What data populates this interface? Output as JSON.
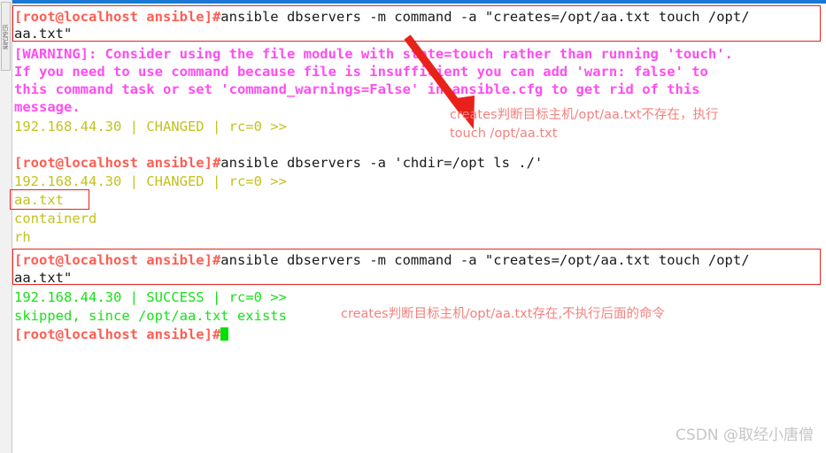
{
  "window": {
    "side_rail_label": "历史记录",
    "accent_color": "#1a78d2"
  },
  "terminal": {
    "background": "#ffffff",
    "colors": {
      "prompt": "#ff5d52",
      "command": "#1a1a1a",
      "warning": "#ff4df0",
      "changed": "#c2c21f",
      "success": "#19e019",
      "cursor": "#00e000",
      "annotation_box": "#e8221b",
      "annotation_text": "#f4827e"
    },
    "prompt_text": "[root@localhost ansible]#",
    "lines": [
      {
        "id": "cmd1",
        "kind": "prompt",
        "prompt": "[root@localhost ansible]#",
        "text": "ansible dbservers -m command -a \"creates=/opt/aa.txt touch /opt/"
      },
      {
        "id": "cmd1-wrap",
        "kind": "command",
        "text": "aa.txt\""
      },
      {
        "id": "warn1",
        "kind": "warning",
        "text": "[WARNING]: Consider using the file module with state=touch rather than running 'touch'."
      },
      {
        "id": "warn2",
        "kind": "warning",
        "text": "If you need to use command because file is insufficient you can add 'warn: false' to"
      },
      {
        "id": "warn3",
        "kind": "warning",
        "text": "this command task or set 'command_warnings=False' in ansible.cfg to get rid of this"
      },
      {
        "id": "warn4",
        "kind": "warning",
        "text": "message."
      },
      {
        "id": "res1",
        "kind": "changed",
        "text": "192.168.44.30 | CHANGED | rc=0 >>"
      },
      {
        "id": "blank1",
        "kind": "blank",
        "text": ""
      },
      {
        "id": "cmd2",
        "kind": "prompt",
        "prompt": "[root@localhost ansible]#",
        "text": "ansible dbservers -a 'chdir=/opt ls ./'"
      },
      {
        "id": "res2",
        "kind": "changed",
        "text": "192.168.44.30 | CHANGED | rc=0 >>"
      },
      {
        "id": "ls1",
        "kind": "changed",
        "text": "aa.txt"
      },
      {
        "id": "ls2",
        "kind": "changed",
        "text": "containerd"
      },
      {
        "id": "ls3",
        "kind": "changed",
        "text": "rh"
      },
      {
        "id": "cmd3",
        "kind": "prompt",
        "prompt": "[root@localhost ansible]#",
        "text": "ansible dbservers -m command -a \"creates=/opt/aa.txt touch /opt/"
      },
      {
        "id": "cmd3-wrap",
        "kind": "command",
        "text": "aa.txt\""
      },
      {
        "id": "res3",
        "kind": "success",
        "text": "192.168.44.30 | SUCCESS | rc=0 >>"
      },
      {
        "id": "skipmsg",
        "kind": "success",
        "text": "skipped, since /opt/aa.txt exists"
      },
      {
        "id": "cmd4",
        "kind": "prompt-cursor",
        "prompt": "[root@localhost ansible]#",
        "text": ""
      }
    ]
  },
  "annotations": {
    "note_top": {
      "line1": "creates判断目标主机/opt/aa.txt不存在，执行",
      "line2": "touch /opt/aa.txt"
    },
    "note_bottom": {
      "line1": "creates判断目标主机/opt/aa.txt存在,不执行后面的命令"
    },
    "boxes": [
      {
        "id": "box-cmd1",
        "label": "highlight-first-command"
      },
      {
        "id": "box-aatxt",
        "label": "highlight-aa-txt-listing"
      },
      {
        "id": "box-cmd3",
        "label": "highlight-third-command"
      }
    ],
    "arrow": {
      "label": "red-down-right-arrow"
    }
  },
  "watermark": {
    "text": "CSDN @取经小唐僧"
  }
}
